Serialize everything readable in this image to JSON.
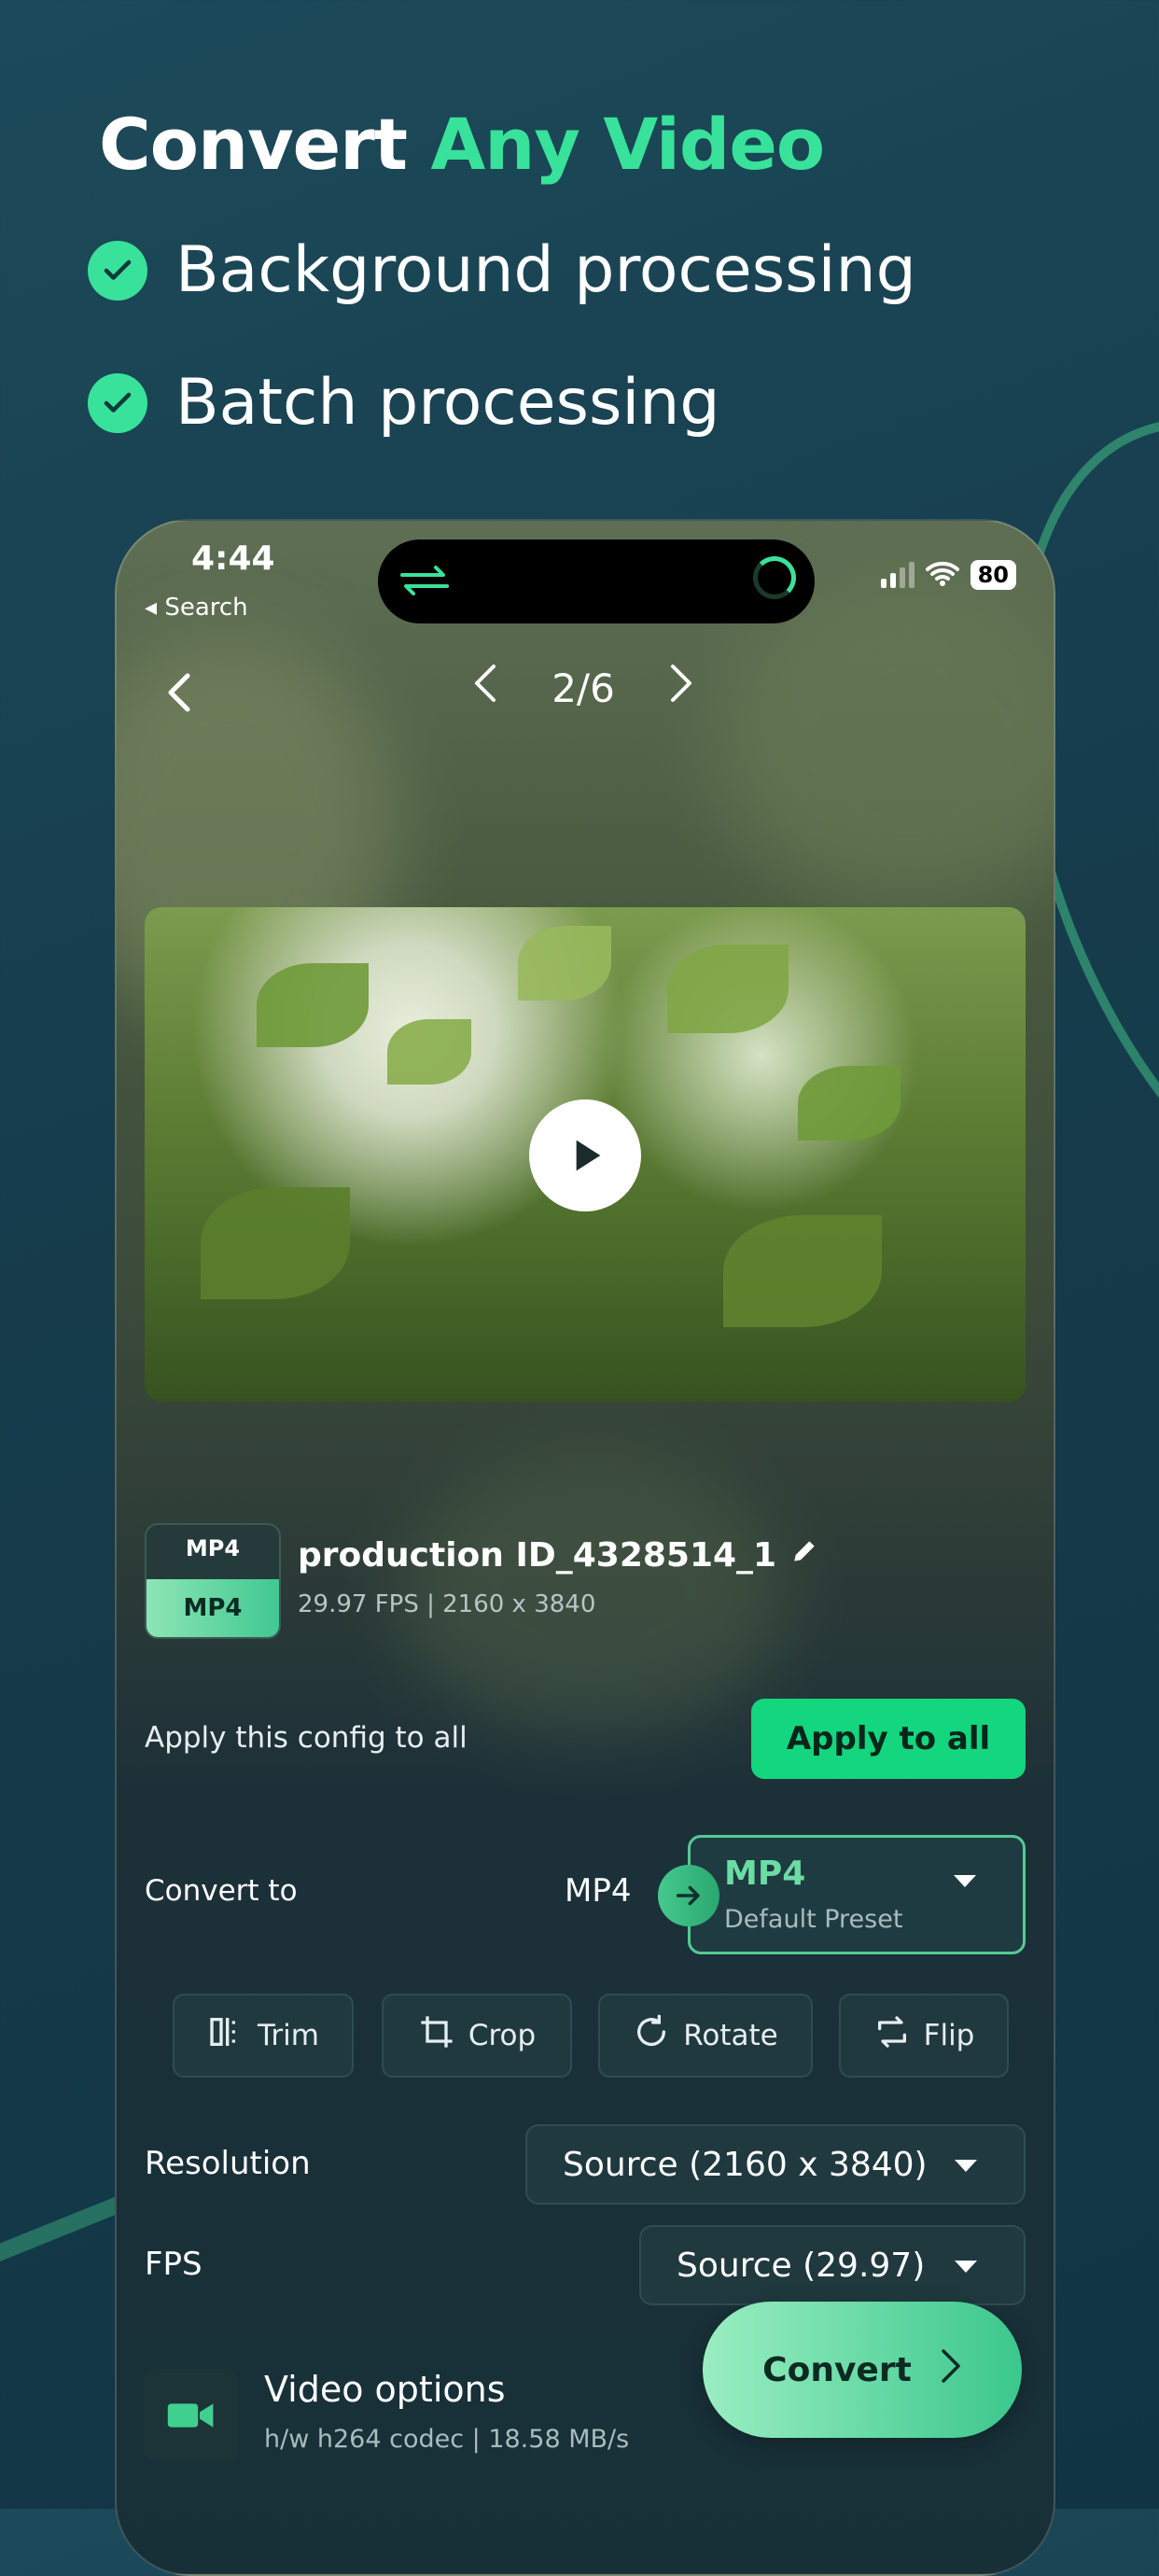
{
  "promo": {
    "headline_part1": "Convert",
    "headline_part2": "Any Video",
    "features": [
      "Background processing",
      "Batch processing"
    ]
  },
  "status_bar": {
    "time": "4:44",
    "back_label": "◂ Search",
    "battery": "80"
  },
  "nav": {
    "pager": "2/6"
  },
  "file": {
    "source_format": "MP4",
    "target_format": "MP4",
    "name": "production ID_4328514_1",
    "meta": "29.97 FPS  |  2160 x 3840"
  },
  "apply": {
    "label": "Apply this config to all",
    "button": "Apply to all"
  },
  "convert_to": {
    "label": "Convert to",
    "source": "MP4",
    "preset_format": "MP4",
    "preset_name": "Default Preset"
  },
  "tools": [
    "Trim",
    "Crop",
    "Rotate",
    "Flip"
  ],
  "resolution": {
    "label": "Resolution",
    "value": "Source (2160 x 3840)"
  },
  "fps": {
    "label": "FPS",
    "value": "Source (29.97)"
  },
  "video_options": {
    "title": "Video options",
    "meta": "h/w h264 codec  |  18.58 MB/s"
  },
  "convert_button": "Convert",
  "colors": {
    "accent": "#38e29a",
    "button": "#13d67e",
    "background": "#163d4d"
  }
}
